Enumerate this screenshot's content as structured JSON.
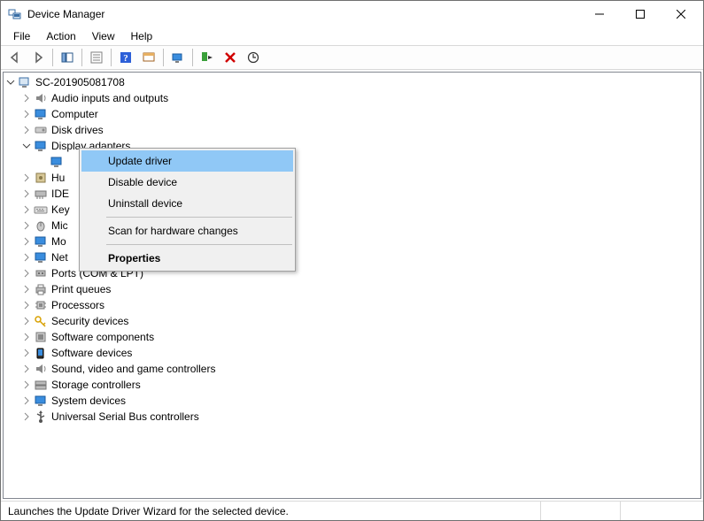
{
  "window": {
    "title": "Device Manager"
  },
  "menu": {
    "file": "File",
    "action": "Action",
    "view": "View",
    "help": "Help"
  },
  "tree": {
    "root": "SC-201905081708",
    "items": [
      "Audio inputs and outputs",
      "Computer",
      "Disk drives",
      "Display adapters",
      "Hu",
      "IDE",
      "Key",
      "Mic",
      "Mo",
      "Net",
      "Ports (COM & LPT)",
      "Print queues",
      "Processors",
      "Security devices",
      "Software components",
      "Software devices",
      "Sound, video and game controllers",
      "Storage controllers",
      "System devices",
      "Universal Serial Bus controllers"
    ]
  },
  "context_menu": {
    "update_driver": "Update driver",
    "disable_device": "Disable device",
    "uninstall_device": "Uninstall device",
    "scan": "Scan for hardware changes",
    "properties": "Properties"
  },
  "status": {
    "text": "Launches the Update Driver Wizard for the selected device."
  }
}
